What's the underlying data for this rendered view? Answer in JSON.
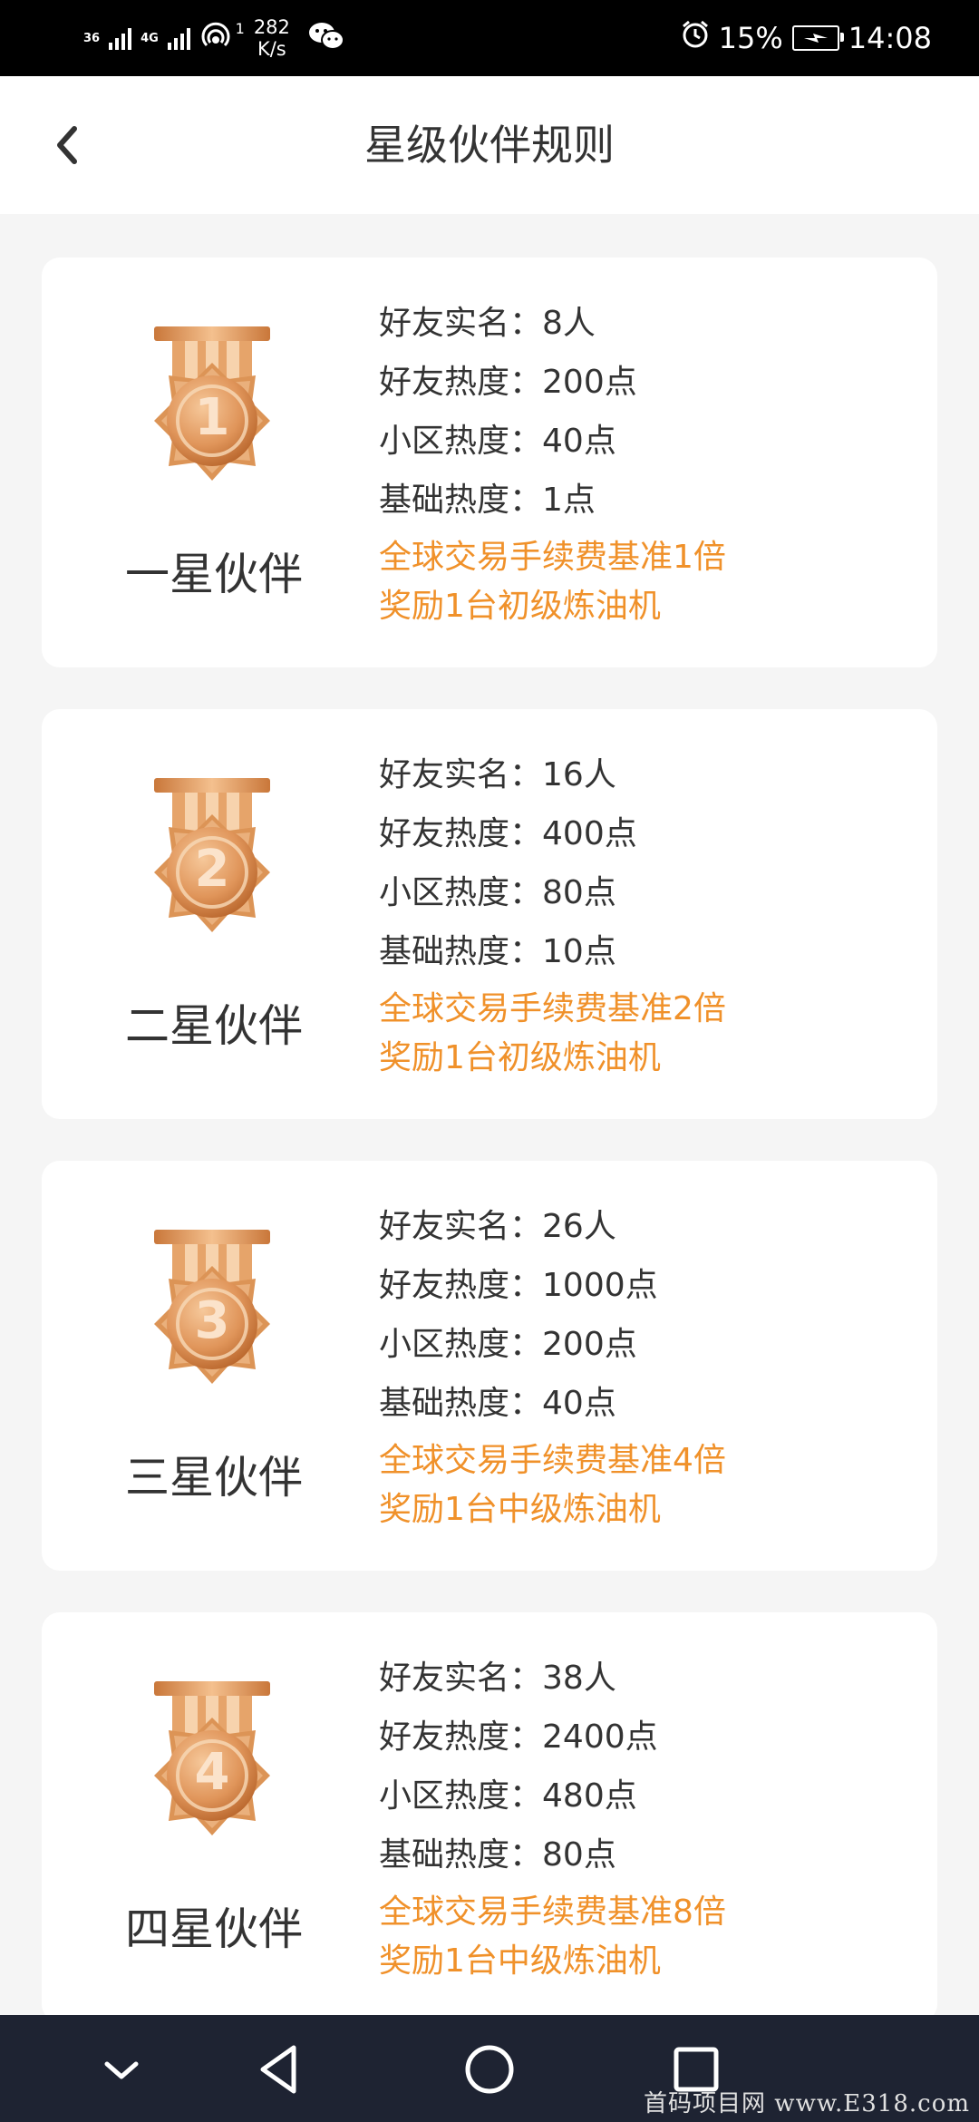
{
  "status_bar": {
    "network_1": "36",
    "network_2": "4G",
    "hotspot_count": "1",
    "speed_value": "282",
    "speed_unit": "K/s",
    "battery": "15%",
    "time": "14:08",
    "icons": [
      "signal-icon",
      "wifi-hotspot-icon",
      "wechat-icon",
      "alarm-icon",
      "battery-charging-icon"
    ]
  },
  "header": {
    "title": "星级伙伴规则",
    "back_icon": "chevron-left-icon"
  },
  "levels": [
    {
      "medal_number": "1",
      "name": "一星伙伴",
      "rows": [
        {
          "label": "好友实名：",
          "value": "8人"
        },
        {
          "label": "好友热度：",
          "value": "200点"
        },
        {
          "label": "小区热度：",
          "value": "40点"
        },
        {
          "label": "基础热度：",
          "value": "1点"
        }
      ],
      "rewards": [
        "全球交易手续费基准1倍",
        "奖励1台初级炼油机"
      ]
    },
    {
      "medal_number": "2",
      "name": "二星伙伴",
      "rows": [
        {
          "label": "好友实名：",
          "value": "16人"
        },
        {
          "label": "好友热度：",
          "value": "400点"
        },
        {
          "label": "小区热度：",
          "value": "80点"
        },
        {
          "label": "基础热度：",
          "value": "10点"
        }
      ],
      "rewards": [
        "全球交易手续费基准2倍",
        "奖励1台初级炼油机"
      ]
    },
    {
      "medal_number": "3",
      "name": "三星伙伴",
      "rows": [
        {
          "label": "好友实名：",
          "value": "26人"
        },
        {
          "label": "好友热度：",
          "value": "1000点"
        },
        {
          "label": "小区热度：",
          "value": "200点"
        },
        {
          "label": "基础热度：",
          "value": "40点"
        }
      ],
      "rewards": [
        "全球交易手续费基准4倍",
        "奖励1台中级炼油机"
      ]
    },
    {
      "medal_number": "4",
      "name": "四星伙伴",
      "rows": [
        {
          "label": "好友实名：",
          "value": "38人"
        },
        {
          "label": "好友热度：",
          "value": "2400点"
        },
        {
          "label": "小区热度：",
          "value": "480点"
        },
        {
          "label": "基础热度：",
          "value": "80点"
        }
      ],
      "rewards": [
        "全球交易手续费基准8倍",
        "奖励1台中级炼油机"
      ]
    }
  ],
  "nav_bar": {
    "icons": [
      "chevron-down-icon",
      "back-triangle-icon",
      "home-circle-icon",
      "recents-square-icon"
    ]
  },
  "watermark": "首码项目网 www.E318.com",
  "colors": {
    "accent": "#f0912a",
    "medal": "#d98a45",
    "nav_bg": "#1e2332"
  }
}
